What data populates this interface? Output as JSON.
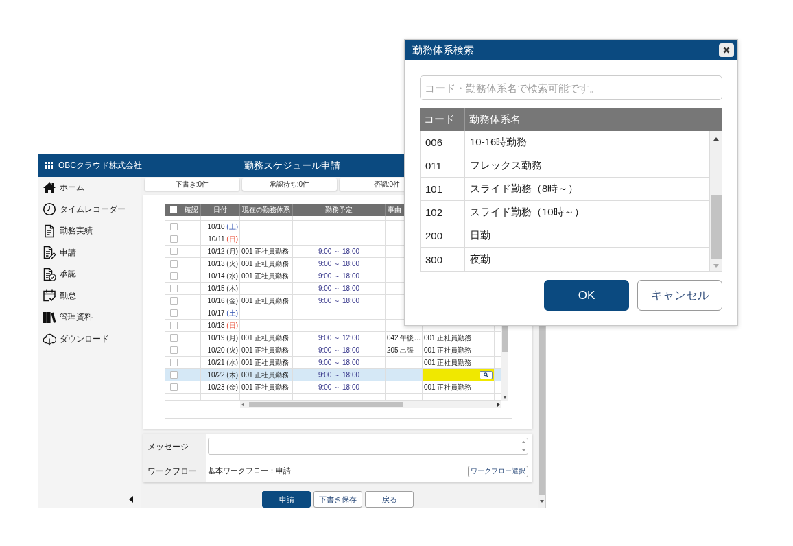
{
  "app": {
    "company": "OBCクラウド株式会社",
    "title": "勤務スケジュール申請"
  },
  "sidebar": {
    "items": [
      {
        "label": "ホーム",
        "selected": false
      },
      {
        "label": "タイムレコーダー",
        "selected": false
      },
      {
        "label": "勤務実績",
        "selected": false
      },
      {
        "label": "申請",
        "selected": false
      },
      {
        "label": "承認",
        "selected": false
      },
      {
        "label": "勤怠",
        "selected": false
      },
      {
        "label": "管理資料",
        "selected": false
      },
      {
        "label": "ダウンロード",
        "selected": false
      }
    ]
  },
  "status_tabs": [
    {
      "label": "下書き:0件"
    },
    {
      "label": "承認待ち:0件"
    },
    {
      "label": "否認:0件"
    }
  ],
  "schedule_table": {
    "header_checked": false,
    "columns": [
      "確認",
      "日付",
      "現在の勤務体系",
      "勤務予定",
      "事由"
    ],
    "rows": [
      {
        "checked": false,
        "selected": false,
        "editing": false,
        "date": "10/10",
        "weekday": "(土)",
        "kind": "saturday"
      },
      {
        "checked": false,
        "selected": false,
        "editing": false,
        "date": "10/11",
        "weekday": "(日)",
        "kind": "sunday"
      },
      {
        "checked": false,
        "selected": false,
        "editing": false,
        "date": "10/12",
        "weekday": "(月)",
        "kind": "weekday",
        "current_pattern": "001 正社員勤務",
        "schedule": "9:00 ～ 18:00"
      },
      {
        "checked": false,
        "selected": false,
        "editing": false,
        "date": "10/13",
        "weekday": "(火)",
        "kind": "weekday",
        "current_pattern": "001 正社員勤務",
        "schedule": "9:00 ～ 18:00"
      },
      {
        "checked": false,
        "selected": false,
        "editing": false,
        "date": "10/14",
        "weekday": "(水)",
        "kind": "weekday",
        "current_pattern": "001 正社員勤務",
        "schedule": "9:00 ～ 18:00"
      },
      {
        "checked": false,
        "selected": false,
        "editing": false,
        "date": "10/15",
        "weekday": "(木)",
        "kind": "weekday",
        "schedule": "9:00 ～ 18:00"
      },
      {
        "checked": false,
        "selected": false,
        "editing": false,
        "date": "10/16",
        "weekday": "(金)",
        "kind": "weekday",
        "current_pattern": "001 正社員勤務",
        "schedule": "9:00 ～ 18:00"
      },
      {
        "checked": false,
        "selected": false,
        "editing": false,
        "date": "10/17",
        "weekday": "(土)",
        "kind": "saturday"
      },
      {
        "checked": false,
        "selected": false,
        "editing": false,
        "date": "10/18",
        "weekday": "(日)",
        "kind": "sunday"
      },
      {
        "checked": false,
        "selected": false,
        "editing": false,
        "date": "10/19",
        "weekday": "(月)",
        "kind": "weekday",
        "current_pattern": "001 正社員勤務",
        "schedule": "9:00 ～ 12:00",
        "reason": "042 午後…",
        "new_pattern": "001 正社員勤務"
      },
      {
        "checked": false,
        "selected": false,
        "editing": false,
        "date": "10/20",
        "weekday": "(火)",
        "kind": "weekday",
        "current_pattern": "001 正社員勤務",
        "schedule": "9:00 ～ 18:00",
        "reason": "205 出張",
        "new_pattern": "001 正社員勤務"
      },
      {
        "checked": false,
        "selected": false,
        "editing": false,
        "date": "10/21",
        "weekday": "(水)",
        "kind": "weekday",
        "current_pattern": "001 正社員勤務",
        "schedule": "9:00 ～ 18:00",
        "new_pattern": "001 正社員勤務"
      },
      {
        "checked": false,
        "selected": true,
        "editing": true,
        "date": "10/22",
        "weekday": "(木)",
        "kind": "weekday",
        "current_pattern": "001 正社員勤務",
        "schedule": "9:00 ～ 18:00"
      },
      {
        "checked": false,
        "selected": false,
        "editing": false,
        "date": "10/23",
        "weekday": "(金)",
        "kind": "weekday",
        "current_pattern": "001 正社員勤務",
        "schedule": "9:00 ～ 18:00",
        "new_pattern": "001 正社員勤務"
      }
    ]
  },
  "message": {
    "label": "メッセージ"
  },
  "workflow": {
    "label": "ワークフロー",
    "value": "基本ワークフロー：申請",
    "button": "ワークフロー選択"
  },
  "actions": [
    {
      "label": "申請",
      "kind": "primary"
    },
    {
      "label": "下書き保存",
      "kind": "secondary"
    },
    {
      "label": "戻る",
      "kind": "secondary"
    }
  ],
  "dialog": {
    "title": "勤務体系検索",
    "search": {
      "placeholder": "コード・勤務体系名で検索可能です。"
    },
    "columns": [
      "コード",
      "勤務体系名"
    ],
    "rows": [
      {
        "code": "006",
        "name": "10-16時勤務"
      },
      {
        "code": "011",
        "name": "フレックス勤務"
      },
      {
        "code": "101",
        "name": "スライド勤務（8時～）"
      },
      {
        "code": "102",
        "name": "スライド勤務（10時～）"
      },
      {
        "code": "200",
        "name": "日勤"
      },
      {
        "code": "300",
        "name": "夜勤"
      }
    ],
    "buttons": [
      {
        "label": "OK",
        "kind": "primary"
      },
      {
        "label": "キャンセル",
        "kind": "secondary"
      }
    ]
  }
}
